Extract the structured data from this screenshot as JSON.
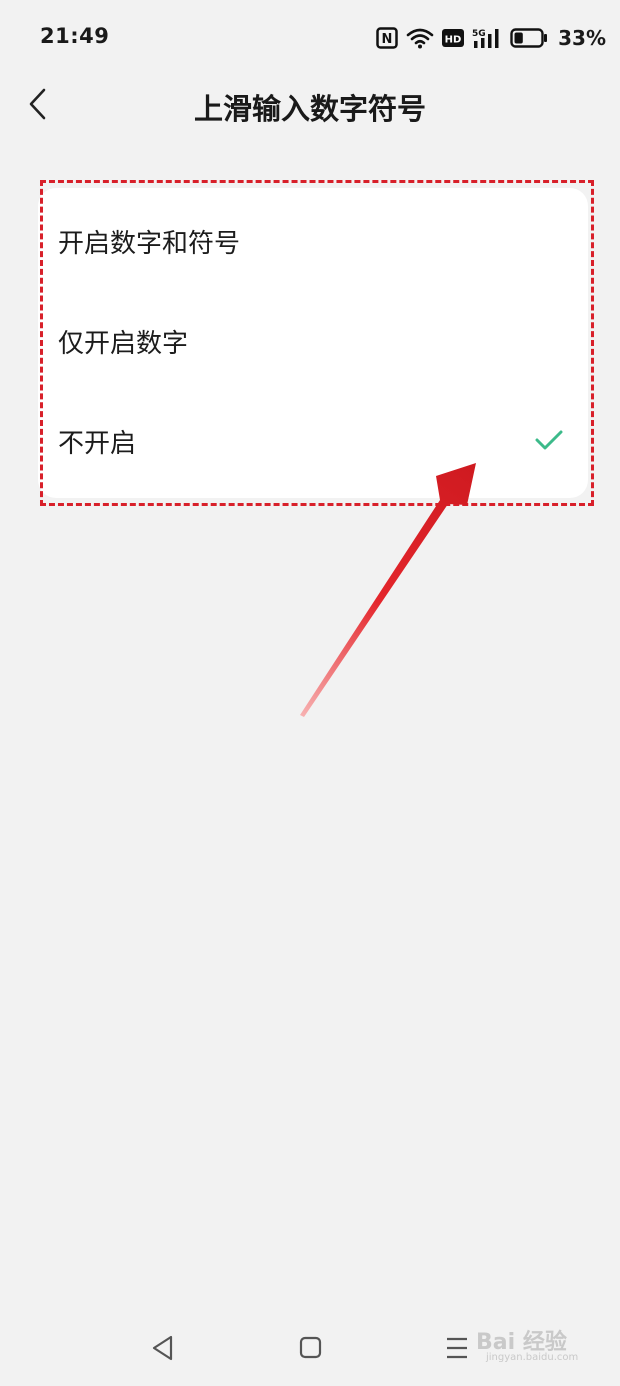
{
  "status_bar": {
    "time": "21:49",
    "battery_percent": "33%",
    "icons": [
      "nfc-icon",
      "wifi-icon",
      "hd-icon",
      "5g-signal-icon",
      "battery-icon"
    ],
    "network_label": "5G",
    "hd_label": "HD",
    "nfc_label": "N",
    "battery_level": 0.33
  },
  "header": {
    "title": "上滑输入数字符号",
    "back_icon": "chevron-left-icon"
  },
  "options": [
    {
      "label": "开启数字和符号",
      "selected": false
    },
    {
      "label": "仅开启数字",
      "selected": false
    },
    {
      "label": "不开启",
      "selected": true
    }
  ],
  "colors": {
    "accent": "#3cba8a",
    "annotation": "#d8202a",
    "background": "#f2f2f2",
    "card": "#ffffff"
  },
  "nav_bar": {
    "icons": [
      "back-triangle-icon",
      "home-square-icon",
      "menu-lines-icon"
    ]
  },
  "watermark": {
    "main": "Bai 经验",
    "sub": "jingyan.baidu.com"
  }
}
